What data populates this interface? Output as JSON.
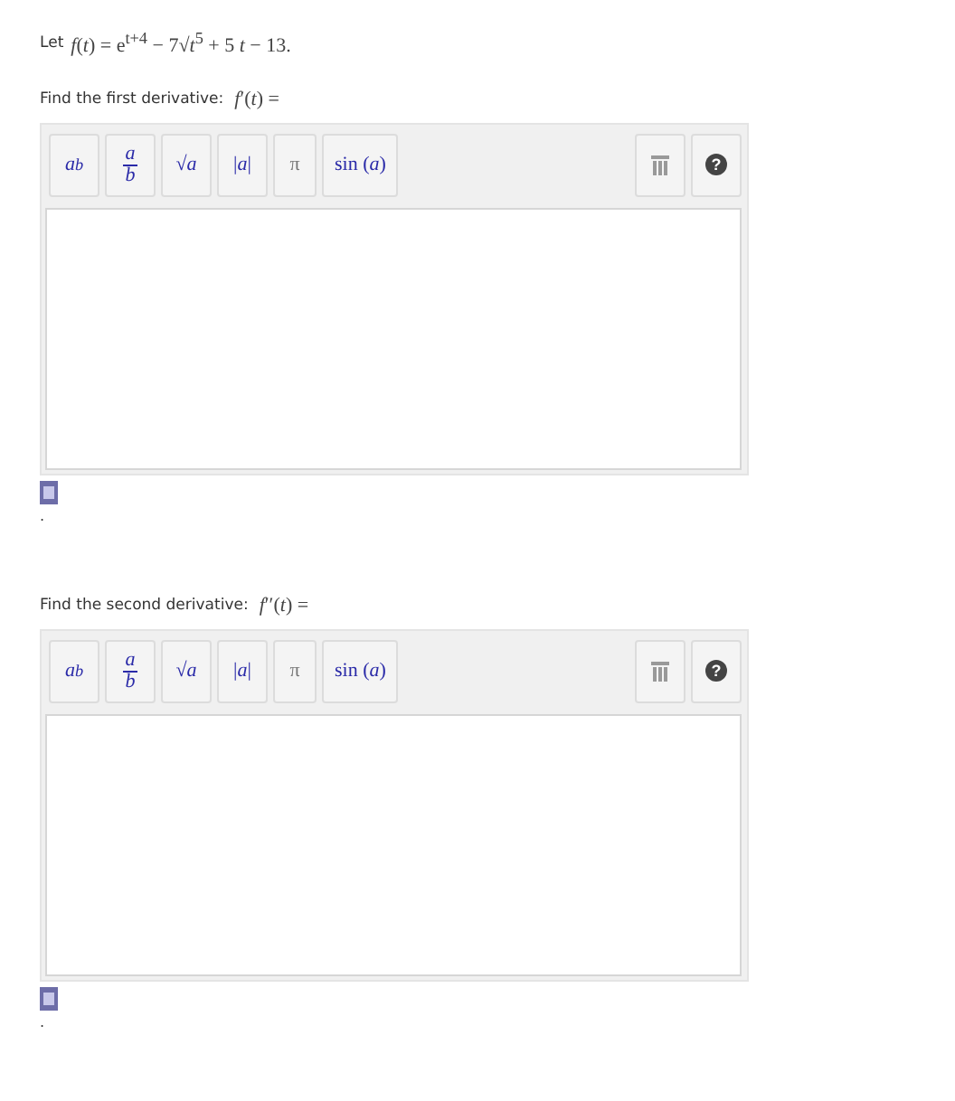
{
  "intro": {
    "prefix": "Let",
    "formula": "*f*(*t*) = e$^{t+4}$ − 7√*t*$^{5}$ + 5 *t* − 13."
  },
  "questions": [
    {
      "prompt": "Find the first derivative:",
      "lhs": "*f*′(*t*) =",
      "tools": [
        {
          "kind": "power",
          "base": "a",
          "exponent": "b"
        },
        {
          "kind": "fraction",
          "numerator": "a",
          "denominator": "b"
        },
        {
          "kind": "plain",
          "label": "√*a*"
        },
        {
          "kind": "plain",
          "label": "|*a*|"
        },
        {
          "kind": "pi",
          "label": "π"
        },
        {
          "kind": "plain",
          "label": "sin (*a*)"
        }
      ],
      "help": "?",
      "after": "."
    },
    {
      "prompt": "Find the second derivative:",
      "lhs": "*f*′′(*t*) =",
      "tools": [
        {
          "kind": "power",
          "base": "a",
          "exponent": "b"
        },
        {
          "kind": "fraction",
          "numerator": "a",
          "denominator": "b"
        },
        {
          "kind": "plain",
          "label": "√*a*"
        },
        {
          "kind": "plain",
          "label": "|*a*|"
        },
        {
          "kind": "pi",
          "label": "π"
        },
        {
          "kind": "plain",
          "label": "sin (*a*)"
        }
      ],
      "help": "?",
      "after": "."
    }
  ]
}
